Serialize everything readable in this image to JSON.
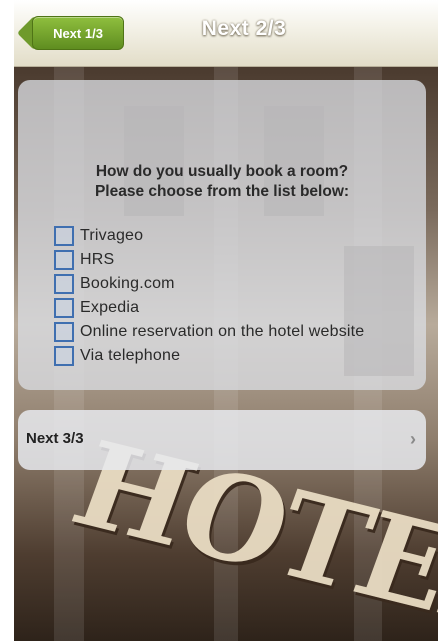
{
  "header": {
    "back_label": "Next 1/3",
    "title": "Next 2/3"
  },
  "question": {
    "line1": "How do you usually book a room?",
    "line2": "Please choose from the list below:"
  },
  "options": [
    {
      "label": "Trivageo",
      "checked": false
    },
    {
      "label": "HRS",
      "checked": false
    },
    {
      "label": "Booking.com",
      "checked": false
    },
    {
      "label": "Expedia",
      "checked": false
    },
    {
      "label": "Online reservation on the hotel website",
      "checked": false
    },
    {
      "label": "Via telephone",
      "checked": false
    }
  ],
  "next": {
    "label": "Next 3/3",
    "chevron": "›"
  },
  "background": {
    "sign_text": "HOTEL"
  },
  "colors": {
    "back_button": "#6f9a2c",
    "checkbox_border": "#3f6fb0"
  }
}
